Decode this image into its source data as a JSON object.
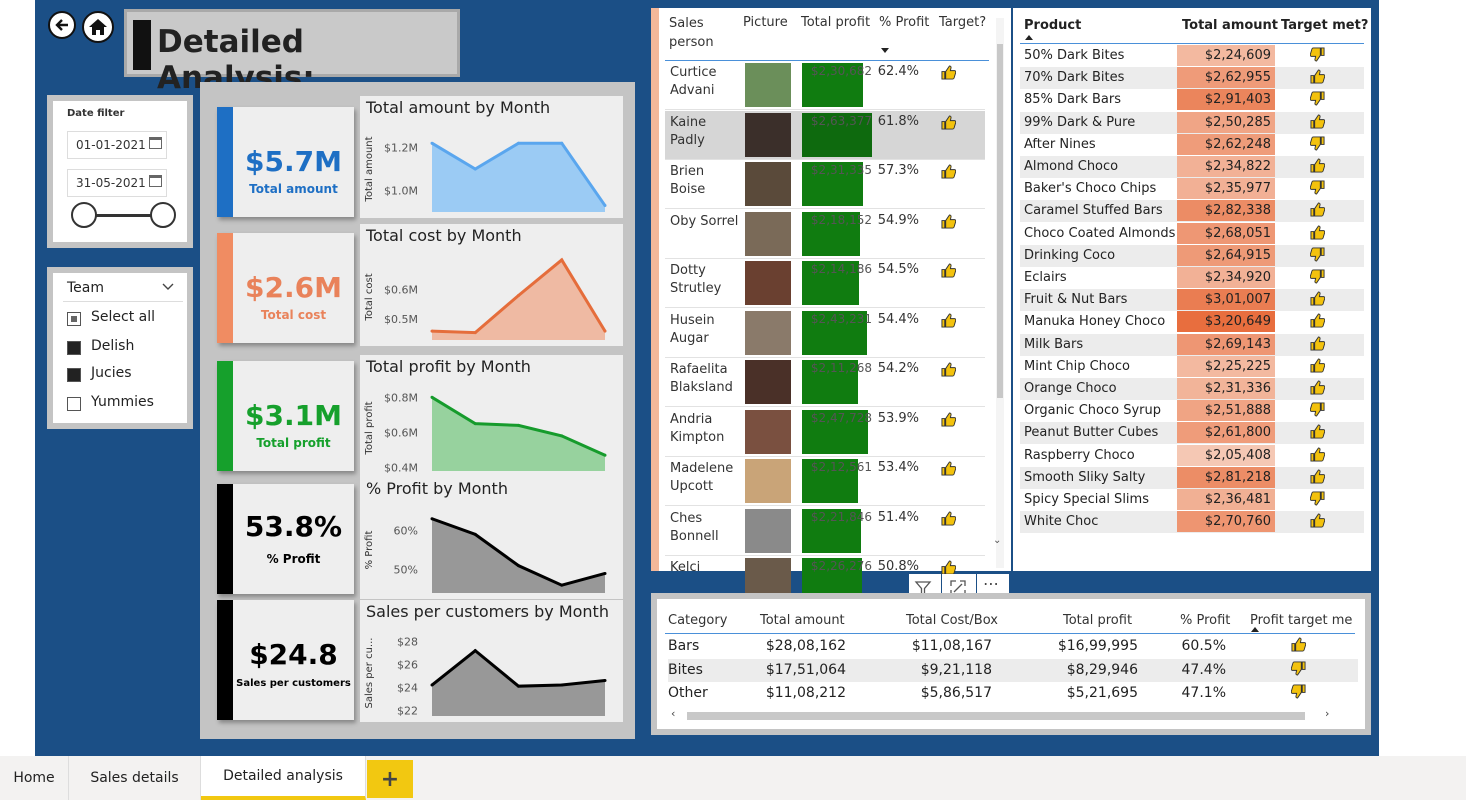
{
  "title": "Detailed Analysis:",
  "date_filter": {
    "label": "Date filter",
    "start": "01-01-2021",
    "end": "31-05-2021"
  },
  "team_filter": {
    "label": "Team",
    "items": [
      {
        "label": "Select all",
        "state": "partial"
      },
      {
        "label": "Delish",
        "state": "checked"
      },
      {
        "label": "Jucies",
        "state": "checked"
      },
      {
        "label": "Yummies",
        "state": "unchecked"
      }
    ]
  },
  "kpis": [
    {
      "value": "$5.7M",
      "label": "Total amount",
      "color": "#1e6fc4"
    },
    {
      "value": "$2.6M",
      "label": "Total cost",
      "color": "#e9825a"
    },
    {
      "value": "$3.1M",
      "label": "Total profit",
      "color": "#16a02c"
    },
    {
      "value": "53.8%",
      "label": "% Profit",
      "color": "#000000"
    },
    {
      "value": "$24.8",
      "label": "Sales per customers",
      "color": "#000000"
    }
  ],
  "chart_data": [
    {
      "type": "area",
      "title": "Total amount by Month",
      "ylabel": "Total amount",
      "ticks": [
        "$1.2M",
        "$1.0M"
      ],
      "ylim": [
        0.9,
        1.3
      ],
      "values": [
        1.22,
        1.1,
        1.22,
        1.22,
        0.93
      ],
      "color": "#5aa6ee",
      "fill": "#8cc4f4"
    },
    {
      "type": "area",
      "title": "Total cost by Month",
      "ylabel": "Total cost",
      "ticks": [
        "$0.6M",
        "$0.5M"
      ],
      "ylim": [
        0.43,
        0.72
      ],
      "values": [
        0.46,
        0.455,
        0.58,
        0.7,
        0.46
      ],
      "color": "#e56d3b",
      "fill": "#eeb095"
    },
    {
      "type": "area",
      "title": "Total profit by Month",
      "ylabel": "Total profit",
      "ticks": [
        "$0.8M",
        "$0.6M",
        "$0.4M"
      ],
      "ylim": [
        0.38,
        0.87
      ],
      "values": [
        0.8,
        0.65,
        0.64,
        0.58,
        0.47
      ],
      "color": "#169b2c",
      "fill": "#87cd8f"
    },
    {
      "type": "area",
      "title": "% Profit by Month",
      "ylabel": "% Profit",
      "ticks": [
        "60%",
        "50%"
      ],
      "ylim": [
        0.44,
        0.66
      ],
      "values": [
        0.63,
        0.59,
        0.51,
        0.46,
        0.49
      ],
      "color": "#000000",
      "fill": "#888888"
    },
    {
      "type": "area",
      "title": "Sales per customers by Month",
      "ylabel": "Sales per cu...",
      "ticks": [
        "$28",
        "$26",
        "$24",
        "$22"
      ],
      "ylim": [
        21.5,
        29
      ],
      "values": [
        24.2,
        27.2,
        24.1,
        24.2,
        24.6
      ],
      "color": "#000000",
      "fill": "#888888"
    }
  ],
  "sales_table": {
    "headers": [
      "Sales person",
      "Picture",
      "Total profit",
      "% Profit",
      "Target?"
    ],
    "rows": [
      {
        "name": "Curtice Advani",
        "profit": "$2,30,682",
        "pct": "62.4%",
        "profit_value": 230682,
        "target": "up"
      },
      {
        "name": "Kaine Padly",
        "profit": "$2,63,377",
        "pct": "61.8%",
        "profit_value": 263377,
        "target": "up"
      },
      {
        "name": "Brien Boise",
        "profit": "$2,31,335",
        "pct": "57.3%",
        "profit_value": 231335,
        "target": "up"
      },
      {
        "name": "Oby Sorrel",
        "profit": "$2,18,152",
        "pct": "54.9%",
        "profit_value": 218152,
        "target": "up"
      },
      {
        "name": "Dotty Strutley",
        "profit": "$2,14,186",
        "pct": "54.5%",
        "profit_value": 214186,
        "target": "up"
      },
      {
        "name": "Husein Augar",
        "profit": "$2,43,231",
        "pct": "54.4%",
        "profit_value": 243231,
        "target": "up"
      },
      {
        "name": "Rafaelita Blaksland",
        "profit": "$2,11,268",
        "pct": "54.2%",
        "profit_value": 211268,
        "target": "up"
      },
      {
        "name": "Andria Kimpton",
        "profit": "$2,47,728",
        "pct": "53.9%",
        "profit_value": 247728,
        "target": "up"
      },
      {
        "name": "Madelene Upcott",
        "profit": "$2,12,561",
        "pct": "53.4%",
        "profit_value": 212561,
        "target": "up"
      },
      {
        "name": "Ches Bonnell",
        "profit": "$2,21,846",
        "pct": "51.4%",
        "profit_value": 221846,
        "target": "up"
      },
      {
        "name": "Kelci",
        "profit": "$2,26,276",
        "pct": "50.8%",
        "profit_value": 226276,
        "target": "up"
      }
    ]
  },
  "product_table": {
    "headers": [
      "Product",
      "Total amount",
      "Target met?"
    ],
    "rows": [
      {
        "name": "50% Dark Bites",
        "amount": "$2,24,609",
        "value": 224609,
        "target": "down"
      },
      {
        "name": "70% Dark Bites",
        "amount": "$2,62,955",
        "value": 262955,
        "target": "up"
      },
      {
        "name": "85% Dark Bars",
        "amount": "$2,91,403",
        "value": 291403,
        "target": "down"
      },
      {
        "name": "99% Dark & Pure",
        "amount": "$2,50,285",
        "value": 250285,
        "target": "up"
      },
      {
        "name": "After Nines",
        "amount": "$2,62,248",
        "value": 262248,
        "target": "down"
      },
      {
        "name": "Almond Choco",
        "amount": "$2,34,822",
        "value": 234822,
        "target": "up"
      },
      {
        "name": "Baker's Choco Chips",
        "amount": "$2,35,977",
        "value": 235977,
        "target": "down"
      },
      {
        "name": "Caramel Stuffed Bars",
        "amount": "$2,82,338",
        "value": 282338,
        "target": "up"
      },
      {
        "name": "Choco Coated Almonds",
        "amount": "$2,68,051",
        "value": 268051,
        "target": "up"
      },
      {
        "name": "Drinking Coco",
        "amount": "$2,64,915",
        "value": 264915,
        "target": "down"
      },
      {
        "name": "Eclairs",
        "amount": "$2,34,920",
        "value": 234920,
        "target": "down"
      },
      {
        "name": "Fruit & Nut Bars",
        "amount": "$3,01,007",
        "value": 301007,
        "target": "up"
      },
      {
        "name": "Manuka Honey Choco",
        "amount": "$3,20,649",
        "value": 320649,
        "target": "up"
      },
      {
        "name": "Milk Bars",
        "amount": "$2,69,143",
        "value": 269143,
        "target": "up"
      },
      {
        "name": "Mint Chip Choco",
        "amount": "$2,25,225",
        "value": 225225,
        "target": "up"
      },
      {
        "name": "Orange Choco",
        "amount": "$2,31,336",
        "value": 231336,
        "target": "up"
      },
      {
        "name": "Organic Choco Syrup",
        "amount": "$2,51,888",
        "value": 251888,
        "target": "down"
      },
      {
        "name": "Peanut Butter Cubes",
        "amount": "$2,61,800",
        "value": 261800,
        "target": "up"
      },
      {
        "name": "Raspberry Choco",
        "amount": "$2,05,408",
        "value": 205408,
        "target": "up"
      },
      {
        "name": "Smooth Sliky Salty",
        "amount": "$2,81,218",
        "value": 281218,
        "target": "up"
      },
      {
        "name": "Spicy Special Slims",
        "amount": "$2,36,481",
        "value": 236481,
        "target": "down"
      },
      {
        "name": "White Choc",
        "amount": "$2,70,760",
        "value": 270760,
        "target": "up"
      }
    ]
  },
  "category_table": {
    "headers": [
      "Category",
      "Total amount",
      "Total Cost/Box",
      "Total profit",
      "% Profit",
      "Profit target met"
    ],
    "rows": [
      {
        "cat": "Bars",
        "amount": "$28,08,162",
        "cost": "$11,08,167",
        "profit": "$16,99,995",
        "pct": "60.5%",
        "target": "up"
      },
      {
        "cat": "Bites",
        "amount": "$17,51,064",
        "cost": "$9,21,118",
        "profit": "$8,29,946",
        "pct": "47.4%",
        "target": "down"
      },
      {
        "cat": "Other",
        "amount": "$11,08,212",
        "cost": "$5,86,517",
        "profit": "$5,21,695",
        "pct": "47.1%",
        "target": "down"
      }
    ]
  },
  "tabs": [
    "Home",
    "Sales details",
    "Detailed analysis"
  ],
  "add_tab": "+"
}
